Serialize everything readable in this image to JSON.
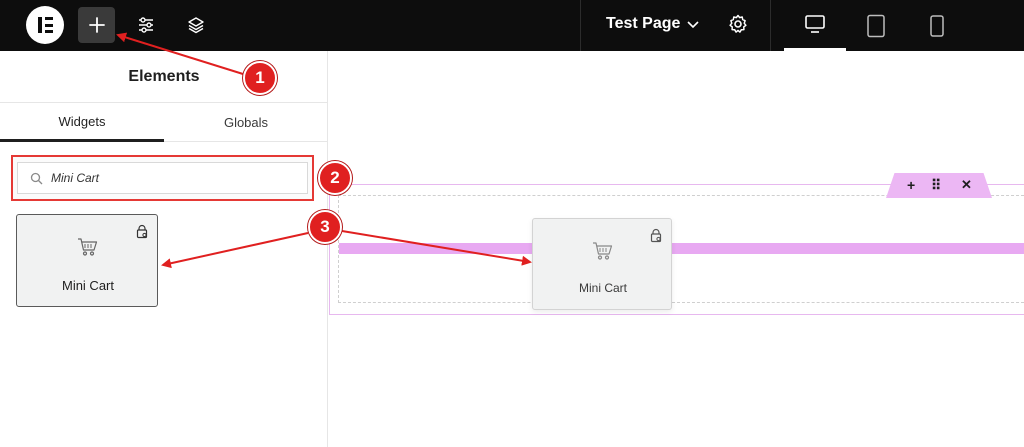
{
  "topbar": {
    "logo_icon": "elementor-logo-icon",
    "add_icon": "plus-icon",
    "settings_icon": "sliders-icon",
    "navigator_icon": "layers-icon",
    "page_title": "Test Page",
    "page_dropdown_icon": "chevron-down-icon",
    "page_settings_icon": "gear-icon",
    "devices": [
      "desktop-icon",
      "tablet-icon",
      "mobile-icon"
    ],
    "active_device": "desktop"
  },
  "panel": {
    "title": "Elements",
    "tabs": [
      {
        "label": "Widgets",
        "active": true
      },
      {
        "label": "Globals",
        "active": false
      }
    ],
    "search": {
      "value": "Mini Cart",
      "icon": "search-icon"
    },
    "results": [
      {
        "label": "Mini Cart",
        "icon": "cart-icon",
        "badge_icon": "lock-icon"
      }
    ]
  },
  "canvas": {
    "section_handle": {
      "add_label": "+",
      "move_label": "⠿",
      "close_label": "✕"
    },
    "dragging_widget": {
      "label": "Mini Cart",
      "icon": "cart-icon",
      "badge_icon": "lock-icon"
    }
  },
  "annotations": [
    {
      "number": "1"
    },
    {
      "number": "2"
    },
    {
      "number": "3"
    }
  ],
  "colors": {
    "topbar_bg": "#0d0d0d",
    "accent_pink": "#e8a9f2",
    "annotation_red": "#e02020"
  }
}
